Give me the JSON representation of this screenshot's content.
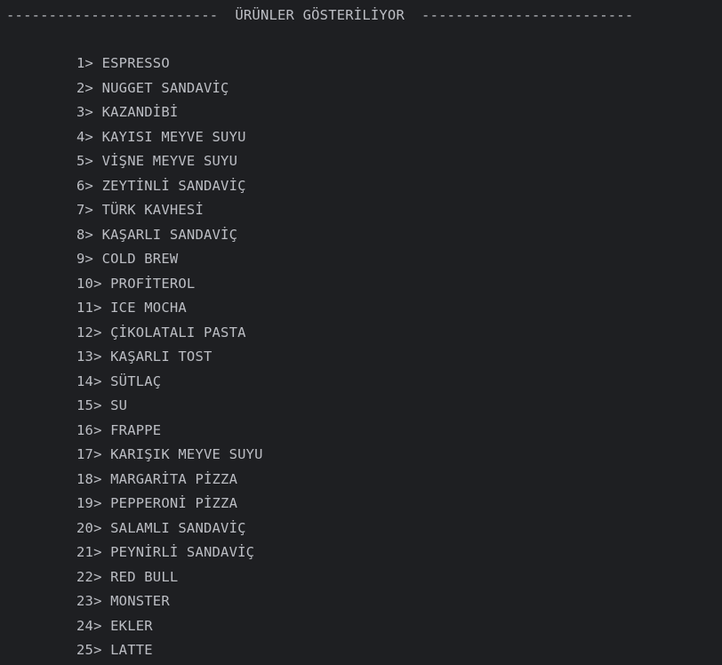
{
  "console": {
    "header": "-------------------------  ÜRÜNLER GÖSTERİLİYOR  -------------------------",
    "products": [
      "1> ESPRESSO",
      "2> NUGGET SANDAVİÇ",
      "3> KAZANDİBİ",
      "4> KAYISI MEYVE SUYU",
      "5> VİŞNE MEYVE SUYU",
      "6> ZEYTİNLİ SANDAVİÇ",
      "7> TÜRK KAVHESİ",
      "8> KAŞARLI SANDAVİÇ",
      "9> COLD BREW",
      "10> PROFİTEROL",
      "11> ICE MOCHA",
      "12> ÇİKOLATALI PASTA",
      "13> KAŞARLI TOST",
      "14> SÜTLAÇ",
      "15> SU",
      "16> FRAPPE",
      "17> KARIŞIK MEYVE SUYU",
      "18> MARGARİTA PİZZA",
      "19> PEPPERONİ PİZZA",
      "20> SALAMLI SANDAVİÇ",
      "21> PEYNİRLİ SANDAVİÇ",
      "22> RED BULL",
      "23> MONSTER",
      "24> EKLER",
      "25> LATTE"
    ]
  },
  "colors": {
    "background": "#1e1f22",
    "text": "#bcbec4"
  }
}
